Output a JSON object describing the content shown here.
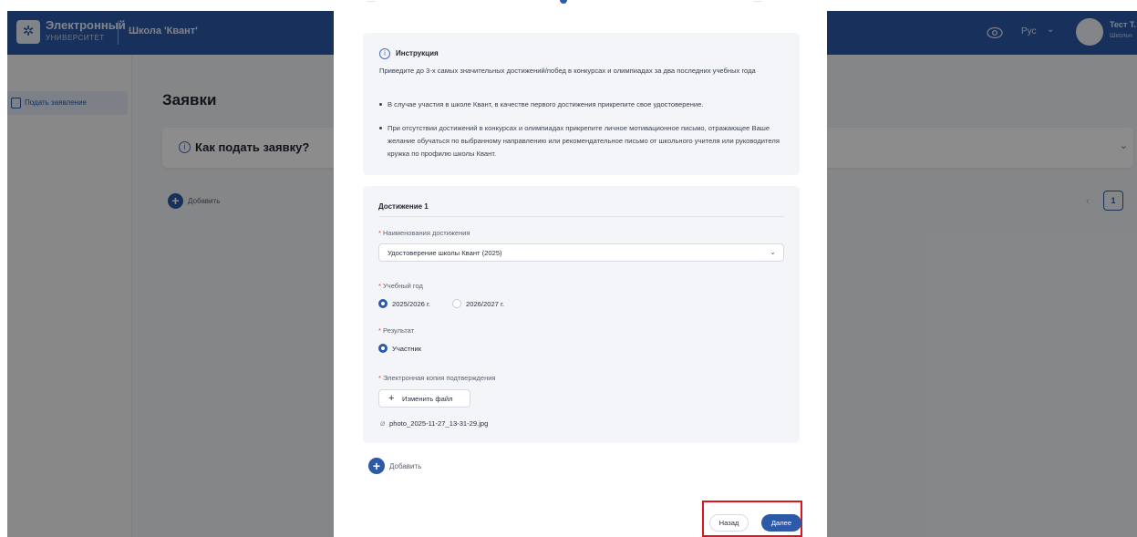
{
  "app": {
    "logo_title": "Электронный",
    "logo_subtitle": "УНИВЕРСИТЕТ",
    "school": "Школа 'Квант'",
    "language": "Рус",
    "user_name": "Тест Т.",
    "user_role": "Школьн"
  },
  "sidebar": {
    "items": [
      {
        "label": "Подать заявление"
      }
    ]
  },
  "page": {
    "title": "Заявки",
    "how_to_apply": "Как подать заявку?",
    "add_label": "Добавить",
    "current_page": "1"
  },
  "modal": {
    "instruction": {
      "title": "Инструкция",
      "intro": "Приведите до 3-х самых значительных достижений/побед в конкурсах и олимпиадах за два последних учебных года",
      "bullets": [
        "В случае участия в школе Квант, в качестве первого достижения прикрепите свое удостоверение.",
        "При отсутствии достижений в конкурсах и олимпиадах прикрепите личное мотивационное письмо, отражающее Ваше желание обучаться по выбранному направлению или рекомендательное письмо от школьного учителя или руководителя кружка по профилю школы Квант."
      ]
    },
    "achievement": {
      "title": "Достижение 1",
      "name_label": "Наименования достижения",
      "name_value": "Удостоверение школы Квант (2025)",
      "year_label": "Учебный год",
      "year_options": [
        "2025/2026 г.",
        "2026/2027 г."
      ],
      "year_selected": 0,
      "result_label": "Результат",
      "result_options": [
        "Участник"
      ],
      "file_label": "Электронная копия подтверждения",
      "change_file_label": "Изменить файл",
      "file_name": "photo_2025-11-27_13-31-29.jpg"
    },
    "add_label": "Добавить",
    "back_label": "Назад",
    "next_label": "Далее"
  },
  "colors": {
    "primary": "#2c5aa8",
    "required": "#e0463c",
    "highlight": "#e0141e"
  }
}
